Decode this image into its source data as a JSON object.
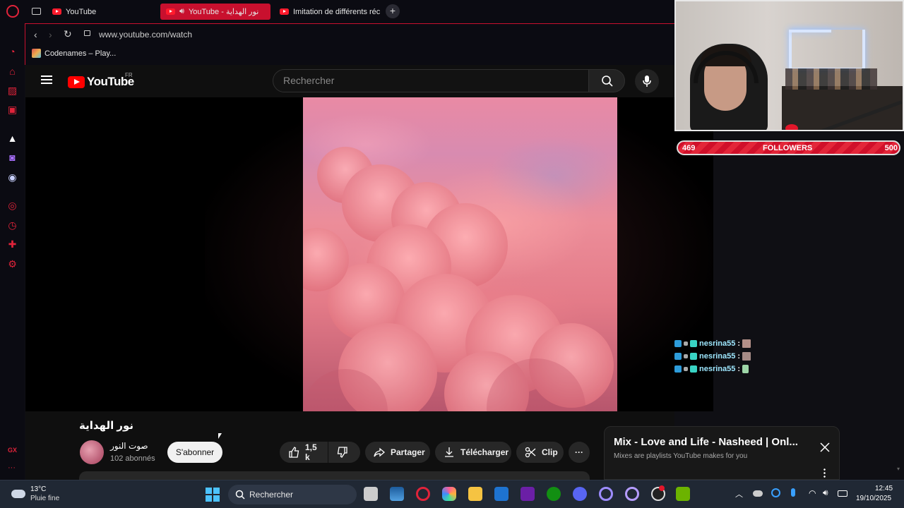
{
  "browser": {
    "tabs": [
      {
        "label": "YouTube",
        "active": false
      },
      {
        "label": "YouTube - نور الهداية",
        "active": true
      },
      {
        "label": "Imitation de différents réc",
        "active": false
      }
    ],
    "new_tab": "+",
    "url": "www.youtube.com/watch",
    "bookmark": "Codenames – Play...",
    "sidebar_badge": "GX",
    "sidebar_more": "···",
    "accent": "#e0233a"
  },
  "youtube": {
    "logo_text": "YouTube",
    "region": "FR",
    "search_placeholder": "Rechercher",
    "video_title": "نور الهداية",
    "channel_name": "صوت النور",
    "channel_subs": "102 abonnés",
    "subscribe_label": "S'abonner",
    "likes": "1,5 k",
    "share_label": "Partager",
    "download_label": "Télécharger",
    "clip_label": "Clip",
    "more_label": "···",
    "mix_title": "Mix - Love and Life - Nasheed | Onl...",
    "mix_subtitle": "Mixes are playlists YouTube makes for you"
  },
  "stream_overlay": {
    "followers_current": "469",
    "followers_label": "FOLLOWERS",
    "followers_goal": "500",
    "followers_progress": 0.938,
    "chat": [
      {
        "user": "nesrina55",
        "sep": ":"
      },
      {
        "user": "nesrina55",
        "sep": ":"
      },
      {
        "user": "nesrina55",
        "sep": ":"
      }
    ]
  },
  "taskbar": {
    "weather_temp": "13°C",
    "weather_desc": "Pluie fine",
    "search_placeholder": "Rechercher",
    "time": "12:45",
    "date": "19/10/2025"
  }
}
